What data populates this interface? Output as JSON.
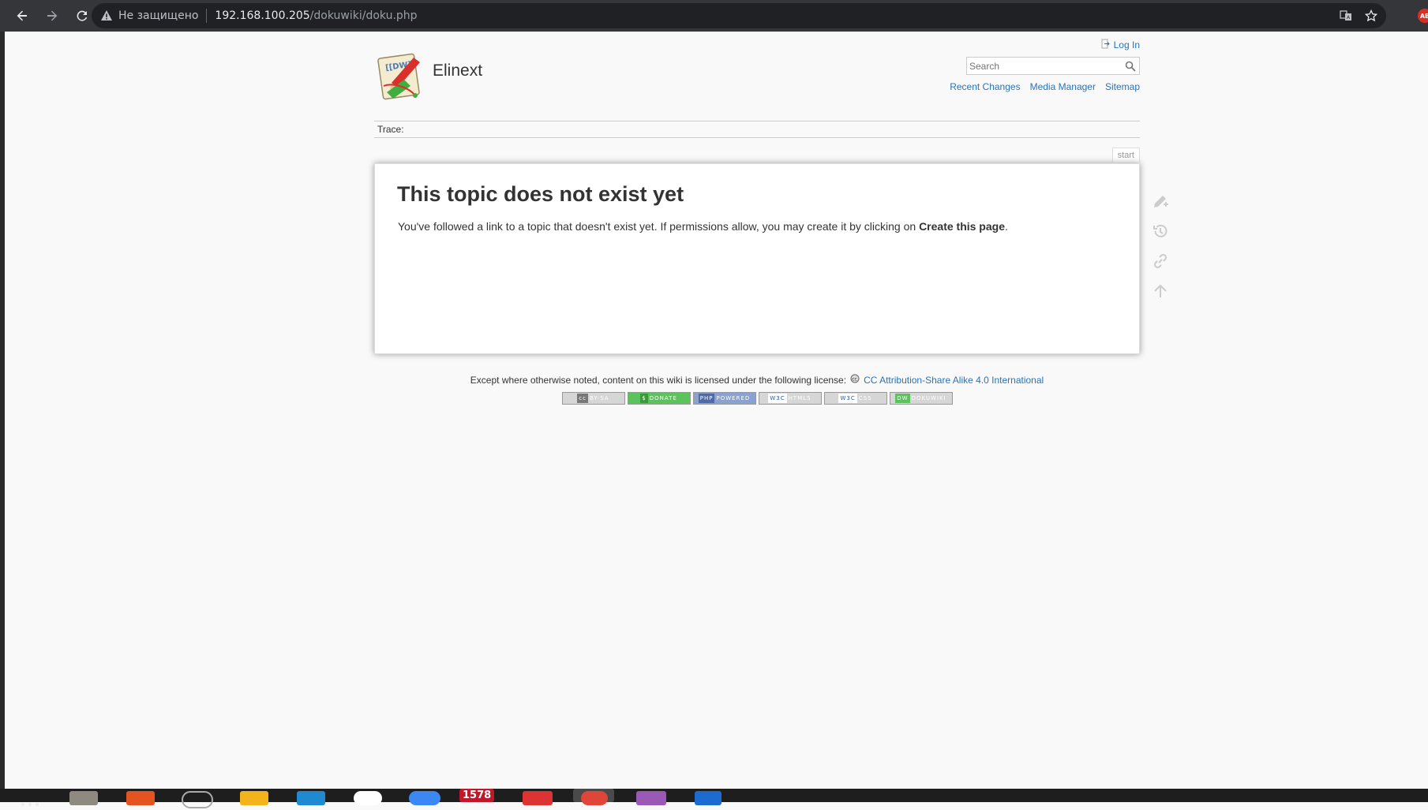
{
  "browser": {
    "security_label": "Не защищено",
    "url_host": "192.168.100.205",
    "url_path": "/dokuwiki/doku.php",
    "extension_badge": "AB"
  },
  "site": {
    "title": "Elinext",
    "login_label": "Log In",
    "search_placeholder": "Search",
    "tools": [
      "Recent Changes",
      "Media Manager",
      "Sitemap"
    ],
    "trace_label": "Trace:",
    "page_id": "start"
  },
  "content": {
    "heading": "This topic does not exist yet",
    "text_before": "You've followed a link to a topic that doesn't exist yet. If permissions allow, you may create it by clicking on ",
    "text_strong": "Create this page",
    "text_after": "."
  },
  "footer": {
    "license_prefix": "Except where otherwise noted, content on this wiki is licensed under the following license:",
    "license_link": "CC Attribution-Share Alike 4.0 International",
    "badges": [
      {
        "left": "cc",
        "right": "BY-SA",
        "color": "#bbbbbb"
      },
      {
        "left": "$",
        "right": "DONATE",
        "color": "#5cc35c"
      },
      {
        "left": "PHP",
        "right": "POWERED",
        "color": "#6f8bc0"
      },
      {
        "left": "W3C",
        "right": "HTML5",
        "color": "#bbbbbb"
      },
      {
        "left": "W3C",
        "right": "CSS",
        "color": "#bbbbbb"
      },
      {
        "left": "DW",
        "right": "DOKUWIKI",
        "color": "#bbbbbb"
      }
    ]
  },
  "taskbar": {
    "badge_count": "1578"
  },
  "colors": {
    "link": "#2b73b7",
    "page_bg": "#f9f9f9",
    "chrome_bg": "#35363a"
  }
}
